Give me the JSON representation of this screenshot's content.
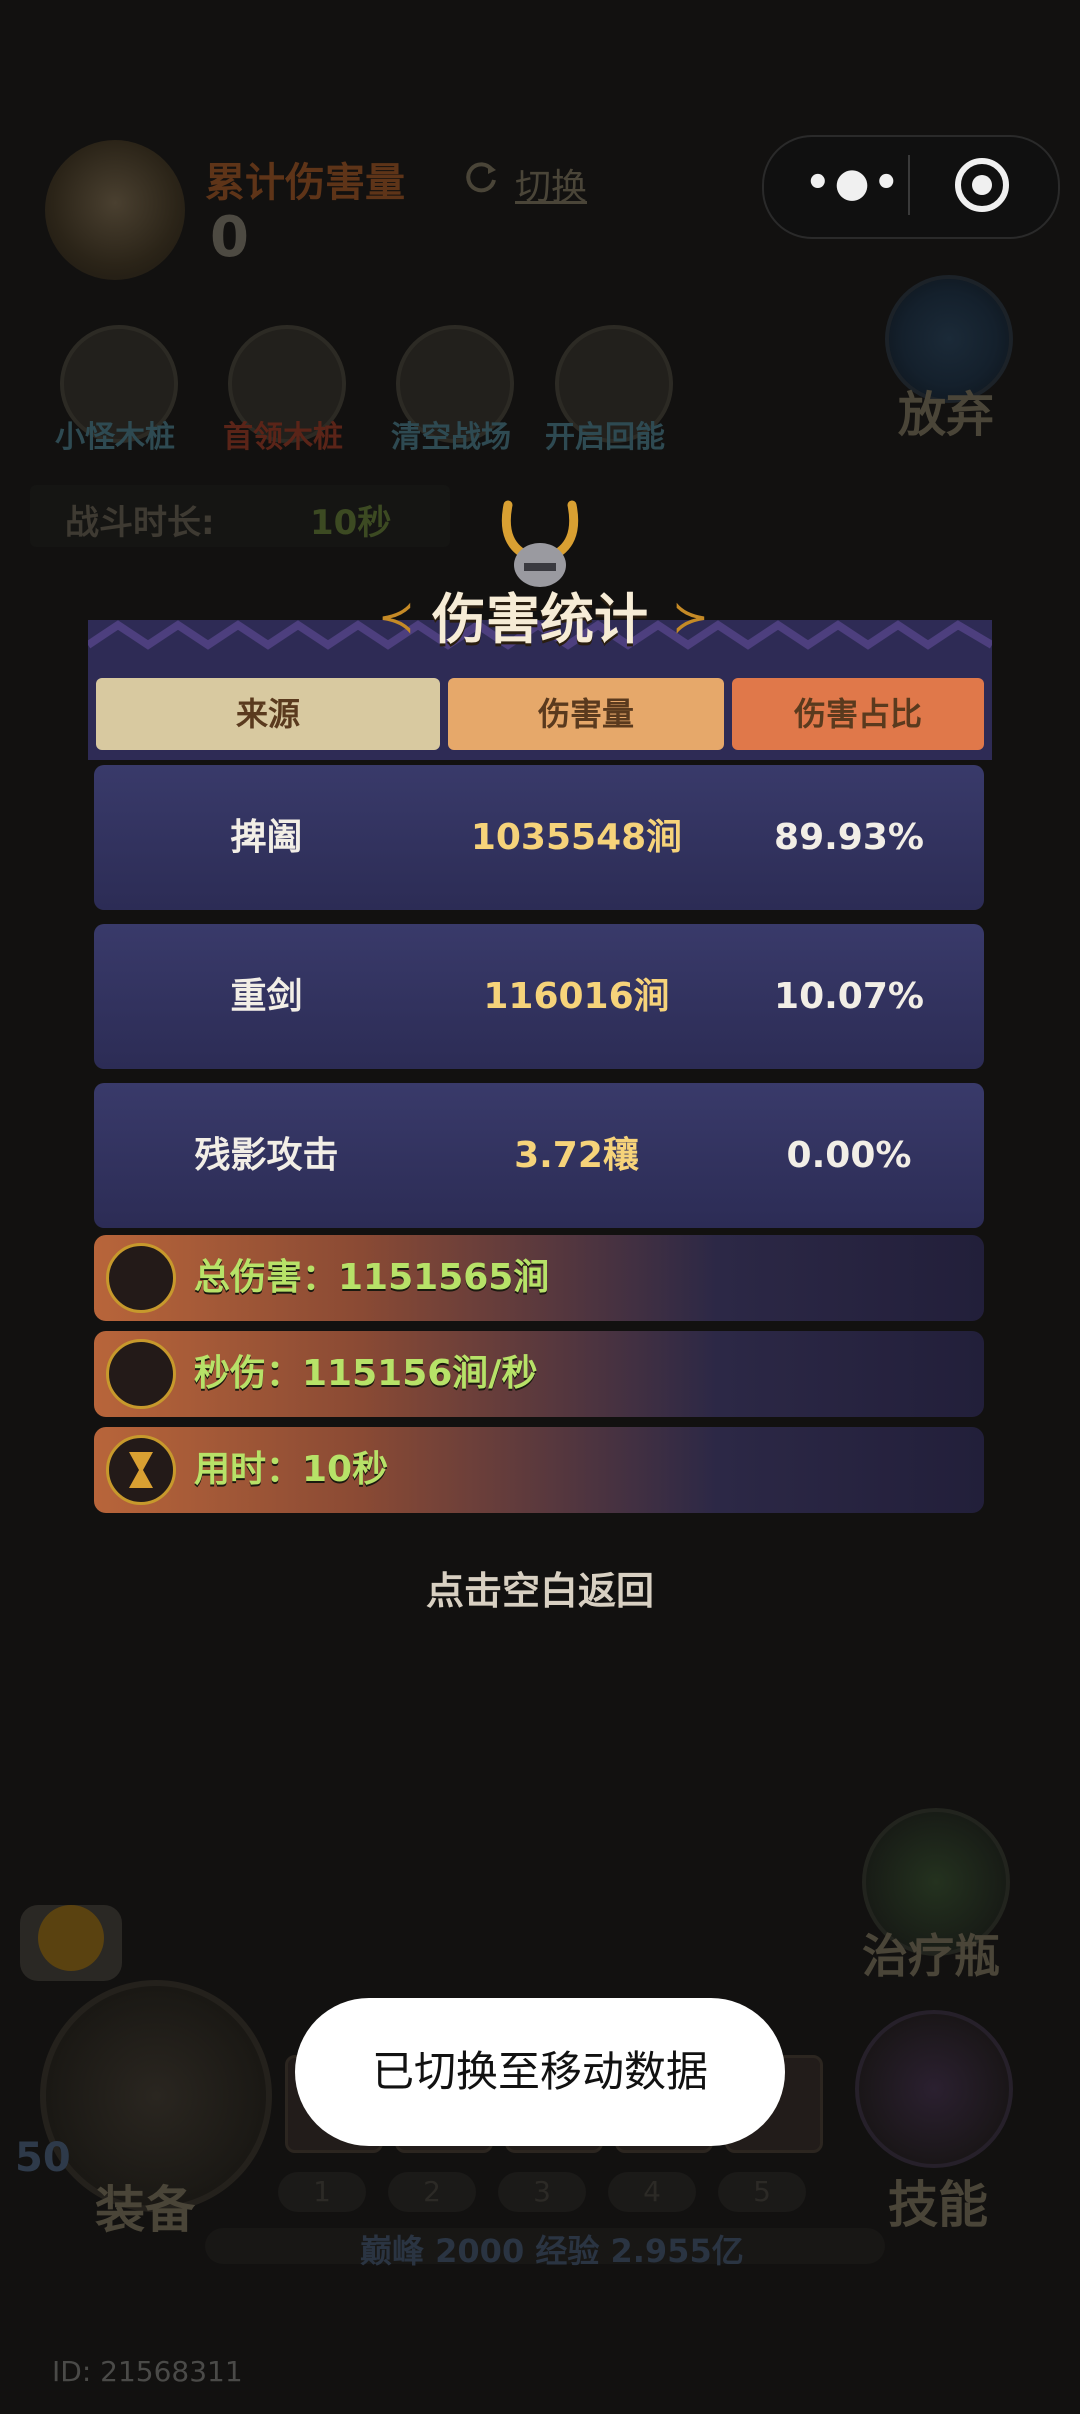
{
  "top_panel": {
    "cumulative_damage_label": "累计伤害量",
    "cumulative_damage_value": "0",
    "switch_label": "切换"
  },
  "capsule": {
    "more_icon": "more-dots-icon",
    "close_icon": "target-close-icon"
  },
  "tools": [
    {
      "label": "小怪木桩"
    },
    {
      "label": "首领木桩"
    },
    {
      "label": "清空战场"
    },
    {
      "label": "开启回能"
    }
  ],
  "give_up_label": "放弃",
  "battle": {
    "duration_label": "战斗时长:",
    "duration_value": "10秒"
  },
  "modal": {
    "title": "伤害统计",
    "headers": {
      "source": "来源",
      "damage": "伤害量",
      "share": "伤害占比"
    },
    "rows": [
      {
        "source": "捭阖",
        "damage": "1035548涧",
        "share": "89.93%"
      },
      {
        "source": "重剑",
        "damage": "116016涧",
        "share": "10.07%"
      },
      {
        "source": "残影攻击",
        "damage": "3.72穰",
        "share": "0.00%"
      }
    ],
    "summary": {
      "total": "总伤害：1151565涧",
      "dps": "秒伤：115156涧/秒",
      "time": "用时：10秒"
    },
    "return_hint": "点击空白返回"
  },
  "bottom": {
    "heal_label": "治疗瓶",
    "equip_label": "装备",
    "skill_label": "技能",
    "level": "50",
    "slots": [
      "1",
      "2",
      "3",
      "4",
      "5"
    ],
    "exp_text": "巅峰 2000   经验 2.955亿",
    "user_id": "ID: 21568311"
  },
  "toast": "已切换至移动数据",
  "colors": {
    "modal_bg": "#2e2b55",
    "header_source": "#d8c9a0",
    "header_damage": "#e6a86a",
    "header_share": "#e0784a",
    "damage_text": "#f6d37a",
    "summary_text": "#b7e268"
  }
}
